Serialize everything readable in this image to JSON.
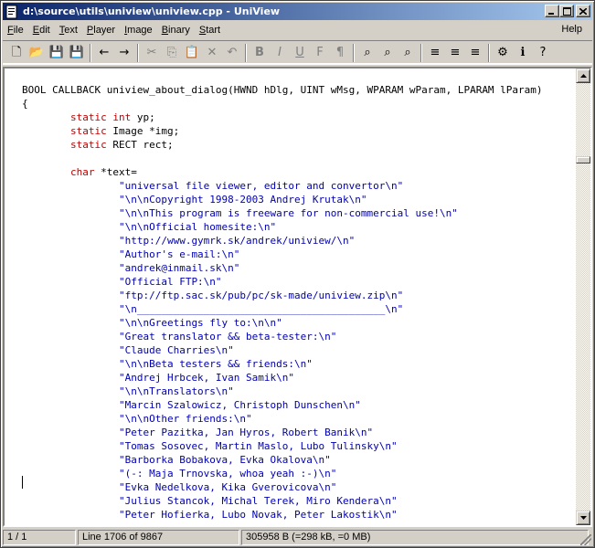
{
  "window": {
    "title": "d:\\source\\utils\\uniview\\uniview.cpp - UniView"
  },
  "menu": {
    "items": [
      {
        "label": "File",
        "hotkey": "F"
      },
      {
        "label": "Edit",
        "hotkey": "E"
      },
      {
        "label": "Text",
        "hotkey": "T"
      },
      {
        "label": "Player",
        "hotkey": "P"
      },
      {
        "label": "Image",
        "hotkey": "I"
      },
      {
        "label": "Binary",
        "hotkey": "B"
      },
      {
        "label": "Start",
        "hotkey": "S"
      }
    ],
    "help": "Help"
  },
  "toolbar": {
    "buttons": [
      {
        "name": "new-file-icon",
        "glyph": "🗋"
      },
      {
        "name": "open-folder-icon",
        "glyph": "📂"
      },
      {
        "name": "save-icon",
        "glyph": "💾"
      },
      {
        "name": "save-all-icon",
        "glyph": "💾"
      },
      {
        "name": "back-arrow-icon",
        "glyph": "←"
      },
      {
        "name": "forward-arrow-icon",
        "glyph": "→"
      },
      {
        "name": "cut-icon",
        "glyph": "✂"
      },
      {
        "name": "copy-icon",
        "glyph": "⎘"
      },
      {
        "name": "paste-icon",
        "glyph": "📋"
      },
      {
        "name": "delete-icon",
        "glyph": "✕"
      },
      {
        "name": "undo-icon",
        "glyph": "↶"
      },
      {
        "name": "bold-icon",
        "glyph": "B"
      },
      {
        "name": "italic-icon",
        "glyph": "I"
      },
      {
        "name": "underline-icon",
        "glyph": "U"
      },
      {
        "name": "font-icon",
        "glyph": "F"
      },
      {
        "name": "format-icon",
        "glyph": "¶"
      },
      {
        "name": "find-icon",
        "glyph": "⌕"
      },
      {
        "name": "find-next-icon",
        "glyph": "⌕"
      },
      {
        "name": "replace-icon",
        "glyph": "⌕"
      },
      {
        "name": "align-left-icon",
        "glyph": "≡"
      },
      {
        "name": "align-center-icon",
        "glyph": "≡"
      },
      {
        "name": "align-right-icon",
        "glyph": "≡"
      },
      {
        "name": "properties-icon",
        "glyph": "⚙"
      },
      {
        "name": "info-icon",
        "glyph": "ℹ"
      },
      {
        "name": "help-icon",
        "glyph": "?"
      }
    ]
  },
  "editor": {
    "lines": [
      "BOOL CALLBACK uniview_about_dialog(HWND hDlg, UINT wMsg, WPARAM wParam, LPARAM lParam)",
      "{",
      "        static int yp;",
      "        static Image *img;",
      "        static RECT rect;",
      "",
      "        char *text=",
      "                \"universal file viewer, editor and convertor\\n\"",
      "                \"\\n\\nCopyright 1998-2003 Andrej Krutak\\n\"",
      "                \"\\n\\nThis program is freeware for non-commercial use!\\n\"",
      "                \"\\n\\nOfficial homesite:\\n\"",
      "                \"http://www.gymrk.sk/andrek/uniview/\\n\"",
      "                \"Author's e-mail:\\n\"",
      "                \"andrek@inmail.sk\\n\"",
      "                \"Official FTP:\\n\"",
      "                \"ftp://ftp.sac.sk/pub/pc/sk-made/uniview.zip\\n\"",
      "                \"\\n_________________________________________\\n\"",
      "                \"\\n\\nGreetings fly to:\\n\\n\"",
      "                \"Great translator && beta-tester:\\n\"",
      "                \"Claude Charries\\n\"",
      "                \"\\n\\nBeta testers && friends:\\n\"",
      "                \"Andrej Hrbcek, Ivan Samik\\n\"",
      "                \"\\n\\nTranslators\\n\"",
      "                \"Marcin Szalowicz, Christoph Dunschen\\n\"",
      "                \"\\n\\nOther friends:\\n\"",
      "                \"Peter Pazitka, Jan Hyros, Robert Banik\\n\"",
      "                \"Tomas Sosovec, Martin Maslo, Lubo Tulinsky\\n\"",
      "                \"Barborka Bobakova, Evka Okalova\\n\"",
      "                \"(-: Maja Trnovska, whoa yeah :-)\\n\"",
      "                \"Evka Nedelkova, Kika Gverovicova\\n\"",
      "                \"Julius Stancok, Michal Terek, Miro Kendera\\n\"",
      "                \"Peter Hofierka, Lubo Novak, Peter Lakostik\\n\""
    ]
  },
  "status": {
    "page": "1 / 1",
    "line": "Line 1706 of 9867",
    "size": "305958 B (=298 kB, =0 MB)"
  }
}
